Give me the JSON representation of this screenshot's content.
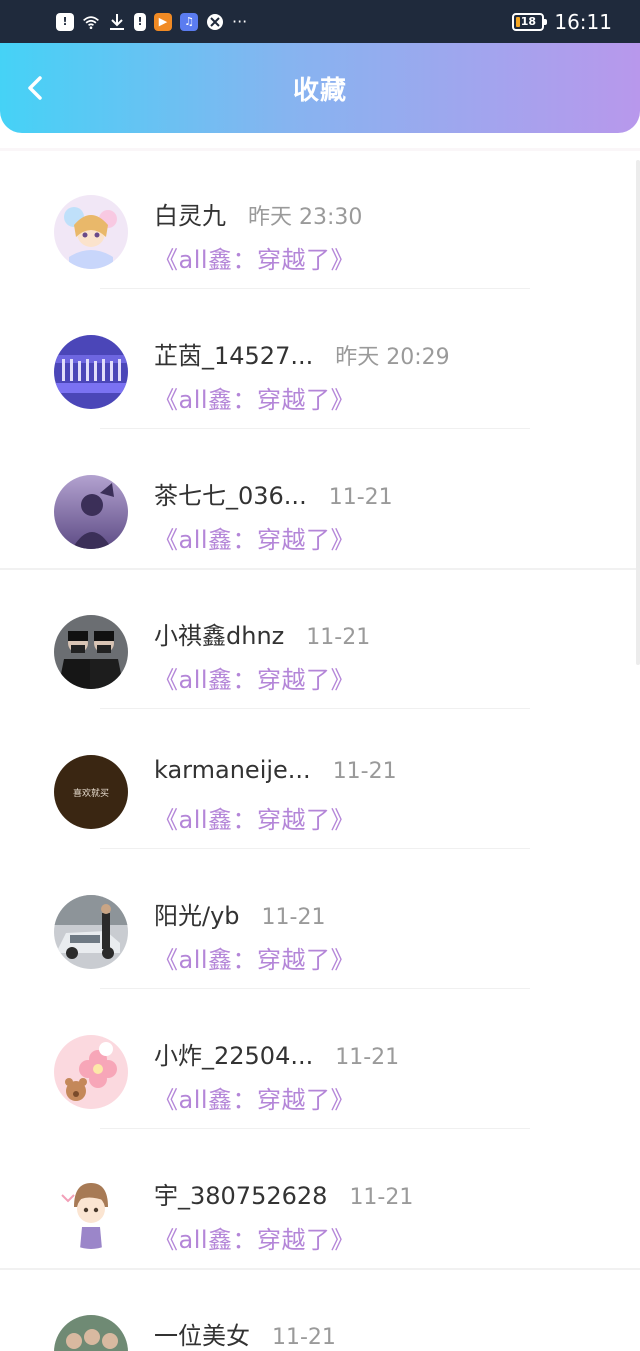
{
  "status_bar": {
    "icons": [
      "alert-icon",
      "wifi-icon",
      "download-icon",
      "sim-icon",
      "video-app-icon",
      "music-app-icon",
      "browser-app-icon"
    ],
    "more": "···",
    "battery": "18",
    "time": "16:11"
  },
  "header": {
    "title": "收藏",
    "gradient_colors": [
      "#45d2f6",
      "#b898ec"
    ]
  },
  "accent_color": "#b486d8",
  "items": [
    {
      "name": "白灵九",
      "time": "昨天 23:30",
      "title": "《all鑫：穿越了》"
    },
    {
      "name": "芷茵_14527...",
      "time": "昨天 20:29",
      "title": "《all鑫：穿越了》"
    },
    {
      "name": "茶七七_036...",
      "time": "11-21",
      "title": "《all鑫：穿越了》"
    },
    {
      "name": "小祺鑫dhnz",
      "time": "11-21",
      "title": "《all鑫：穿越了》"
    },
    {
      "name": "karmaneije...",
      "time": "11-21",
      "title": "《all鑫：穿越了》",
      "avatar_text": "喜欢就买"
    },
    {
      "name": "阳光/yb",
      "time": "11-21",
      "title": "《all鑫：穿越了》"
    },
    {
      "name": "小炸_22504...",
      "time": "11-21",
      "title": "《all鑫：穿越了》"
    },
    {
      "name": "宇_380752628",
      "time": "11-21",
      "title": "《all鑫：穿越了》"
    },
    {
      "name": "一位美女",
      "time": "11-21",
      "title": ""
    }
  ]
}
